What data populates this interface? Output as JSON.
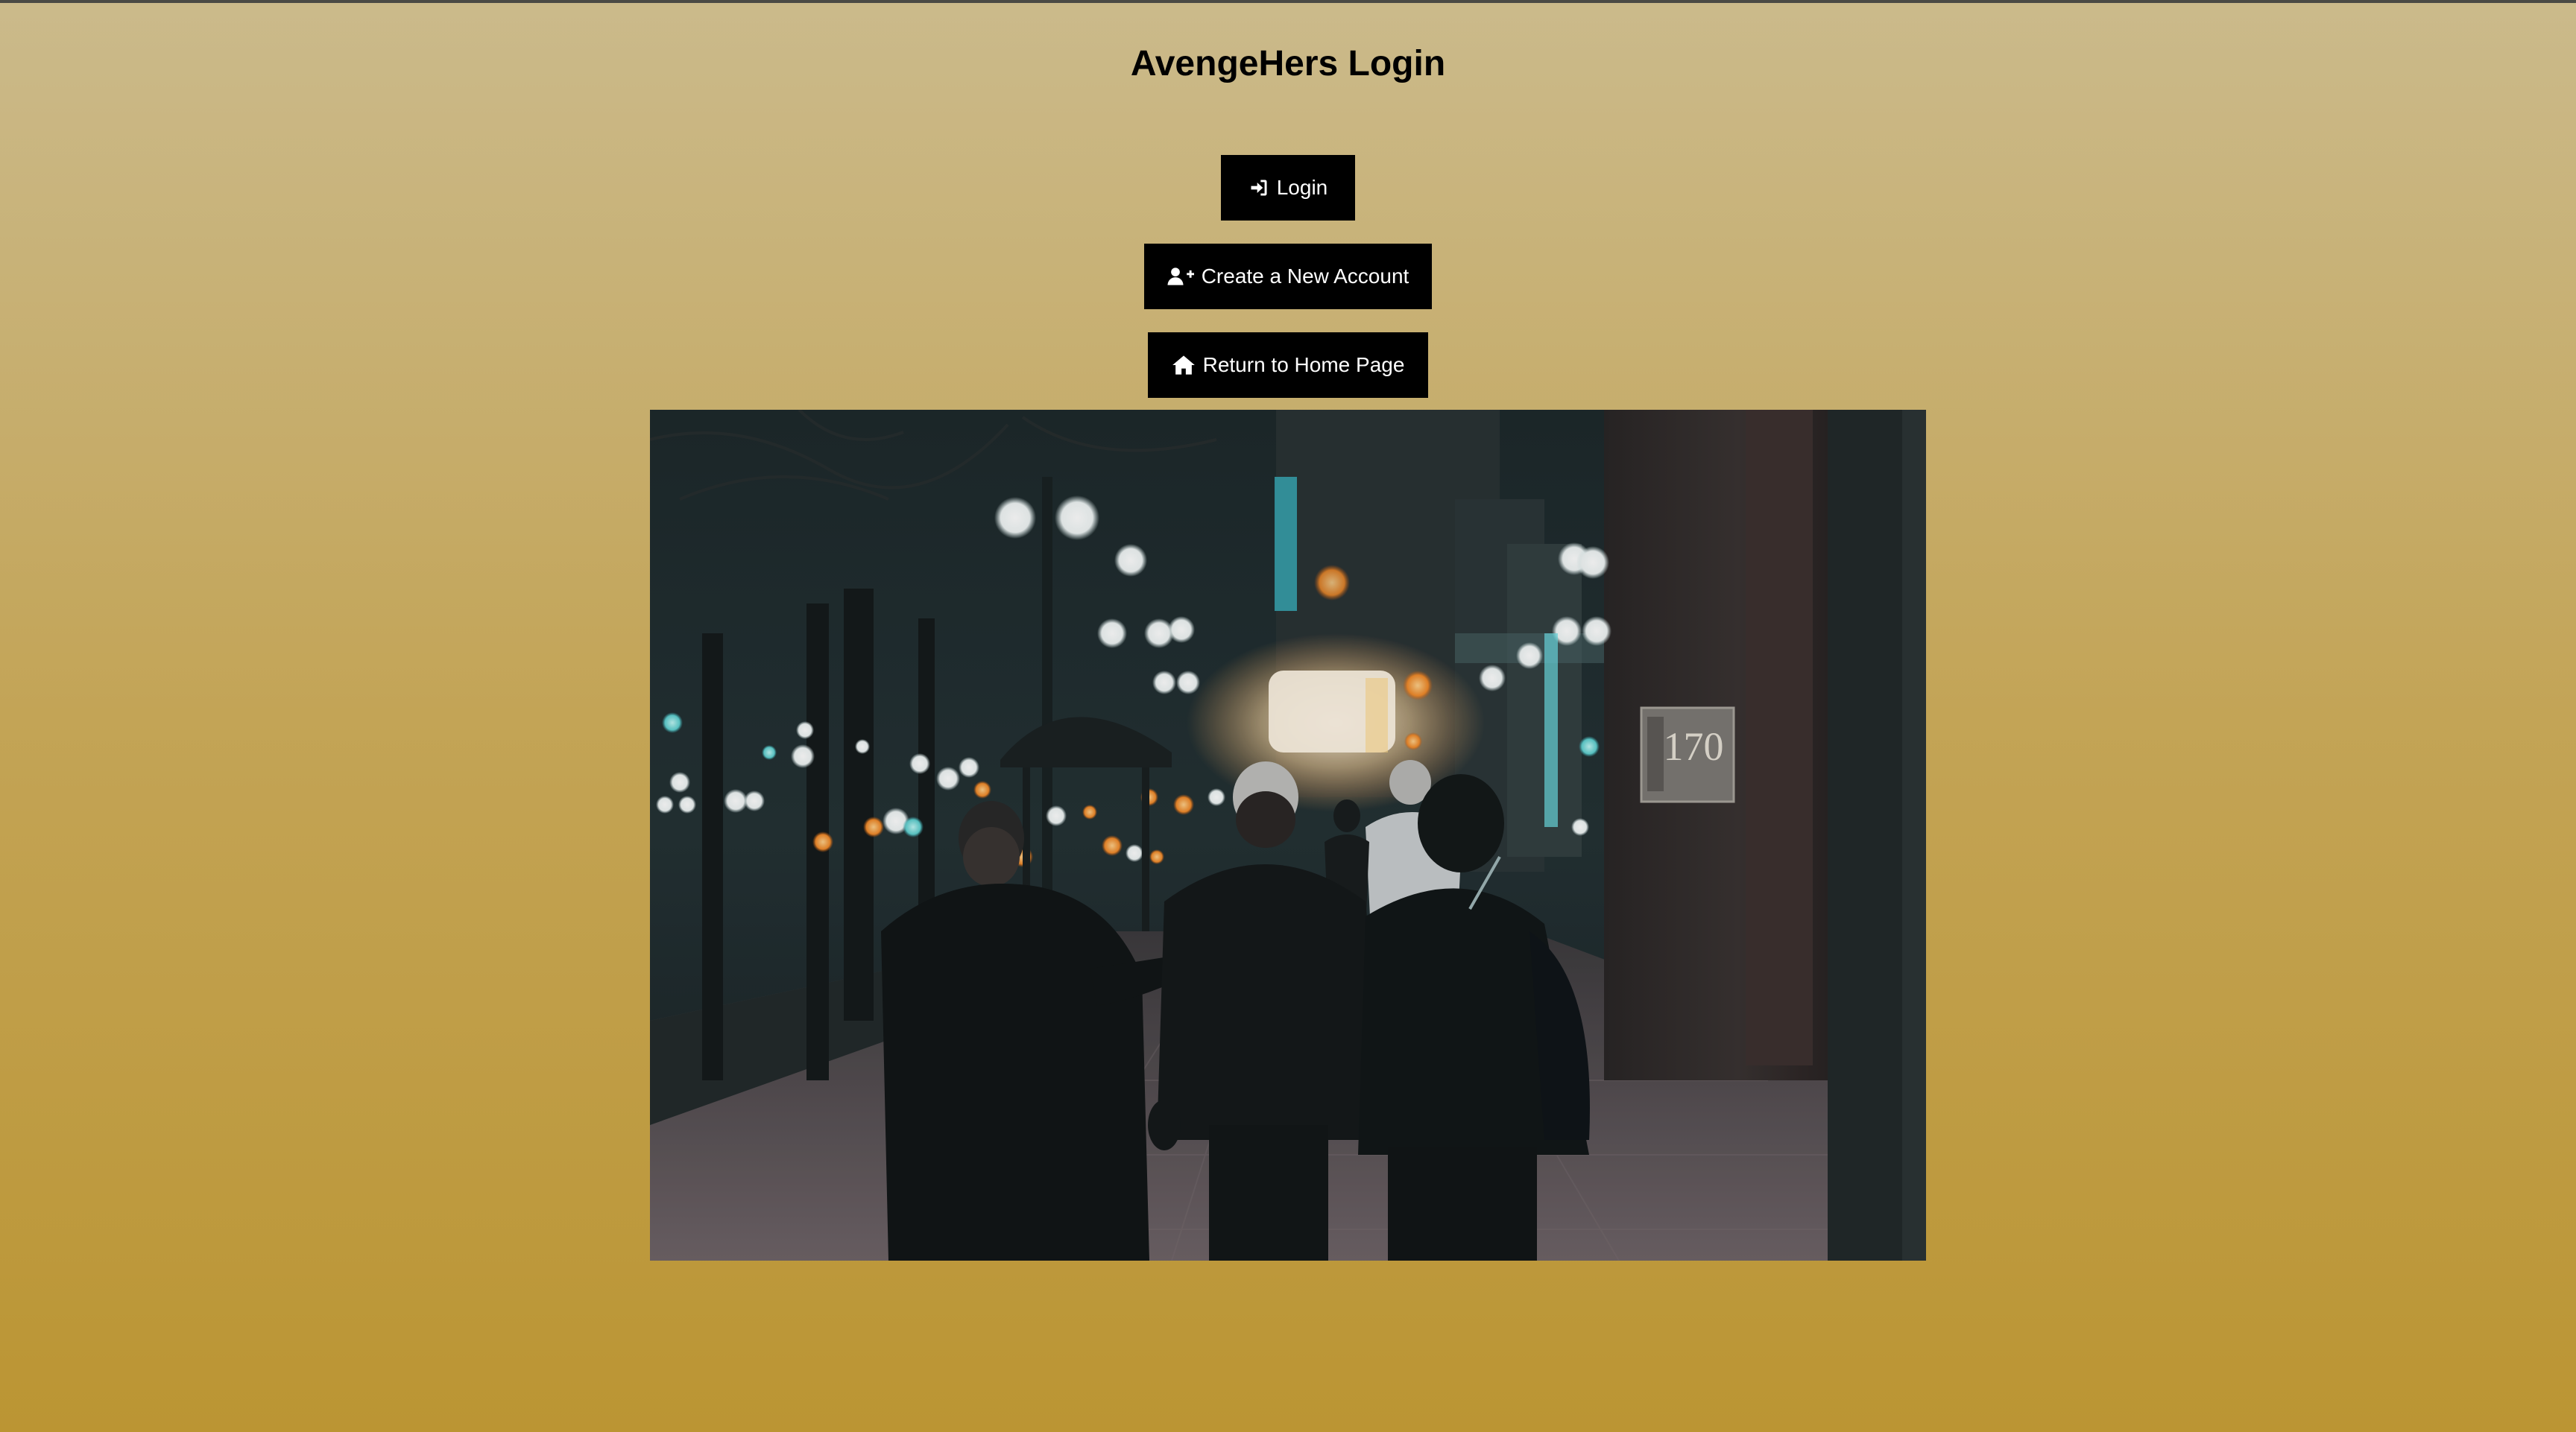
{
  "page": {
    "title": "AvengeHers Login"
  },
  "buttons": {
    "login": {
      "label": "Login",
      "icon": "sign-in-icon"
    },
    "create_account": {
      "label": "Create a New Account",
      "icon": "user-plus-icon"
    },
    "home": {
      "label": "Return to Home Page",
      "icon": "home-icon"
    }
  },
  "hero_image": {
    "building_number": "170"
  },
  "colors": {
    "gradient_top": "#cbba8b",
    "gradient_bottom": "#bb9533",
    "button_bg": "#000000",
    "button_text": "#ffffff"
  }
}
